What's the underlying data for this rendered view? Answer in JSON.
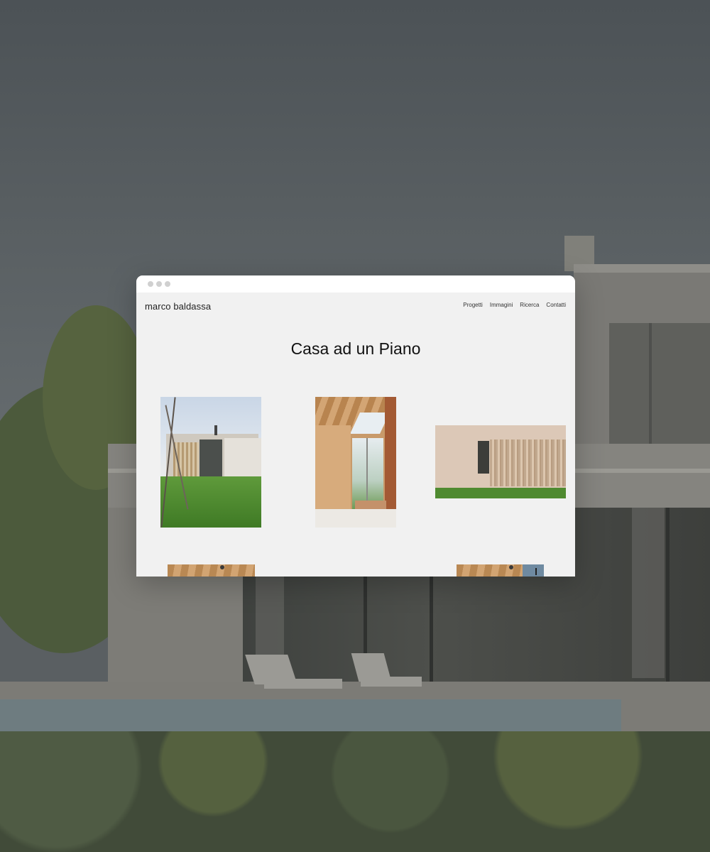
{
  "site": {
    "logo": "marco baldassa",
    "nav": [
      "Progetti",
      "Immagini",
      "Ricerca",
      "Contatti"
    ]
  },
  "page": {
    "title": "Casa ad un Piano"
  },
  "gallery": [
    {
      "subject": "house-exterior-photo"
    },
    {
      "subject": "timber-interior-photo"
    },
    {
      "subject": "facade-slats-photo"
    },
    {
      "subject": "interior-ceiling-photo"
    },
    {
      "subject": "interior-ceiling-window-photo"
    }
  ],
  "colors": {
    "page_background": "#f1f1f1",
    "titlebar": "#ffffff",
    "text": "#111111"
  }
}
